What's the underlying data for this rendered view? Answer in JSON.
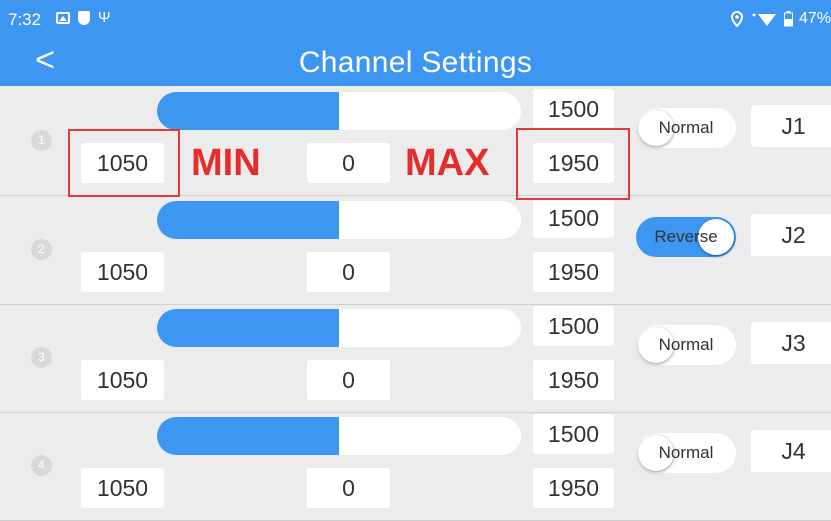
{
  "status": {
    "time": "7:32",
    "battery": "47%",
    "left_icons": [
      "image-icon",
      "shield-icon",
      "usb-icon"
    ],
    "right_icons": [
      "location-icon",
      "wifi-icon",
      "battery-icon"
    ]
  },
  "header": {
    "title": "Channel Settings",
    "back": "<"
  },
  "annotations": {
    "min": "MIN",
    "max": "MAX"
  },
  "colors": {
    "accent": "#3d97f2",
    "annotation": "#e52d2d"
  },
  "channels": [
    {
      "number": "1",
      "min": "1050",
      "subtrim": "0",
      "mid": "1500",
      "max": "1950",
      "direction": "Normal",
      "direction_on": false,
      "mapping": "J1",
      "bar_fraction": 0.5
    },
    {
      "number": "2",
      "min": "1050",
      "subtrim": "0",
      "mid": "1500",
      "max": "1950",
      "direction": "Reverse",
      "direction_on": true,
      "mapping": "J2",
      "bar_fraction": 0.5
    },
    {
      "number": "3",
      "min": "1050",
      "subtrim": "0",
      "mid": "1500",
      "max": "1950",
      "direction": "Normal",
      "direction_on": false,
      "mapping": "J3",
      "bar_fraction": 0.5
    },
    {
      "number": "4",
      "min": "1050",
      "subtrim": "0",
      "mid": "1500",
      "max": "1950",
      "direction": "Normal",
      "direction_on": false,
      "mapping": "J4",
      "bar_fraction": 0.5
    }
  ]
}
